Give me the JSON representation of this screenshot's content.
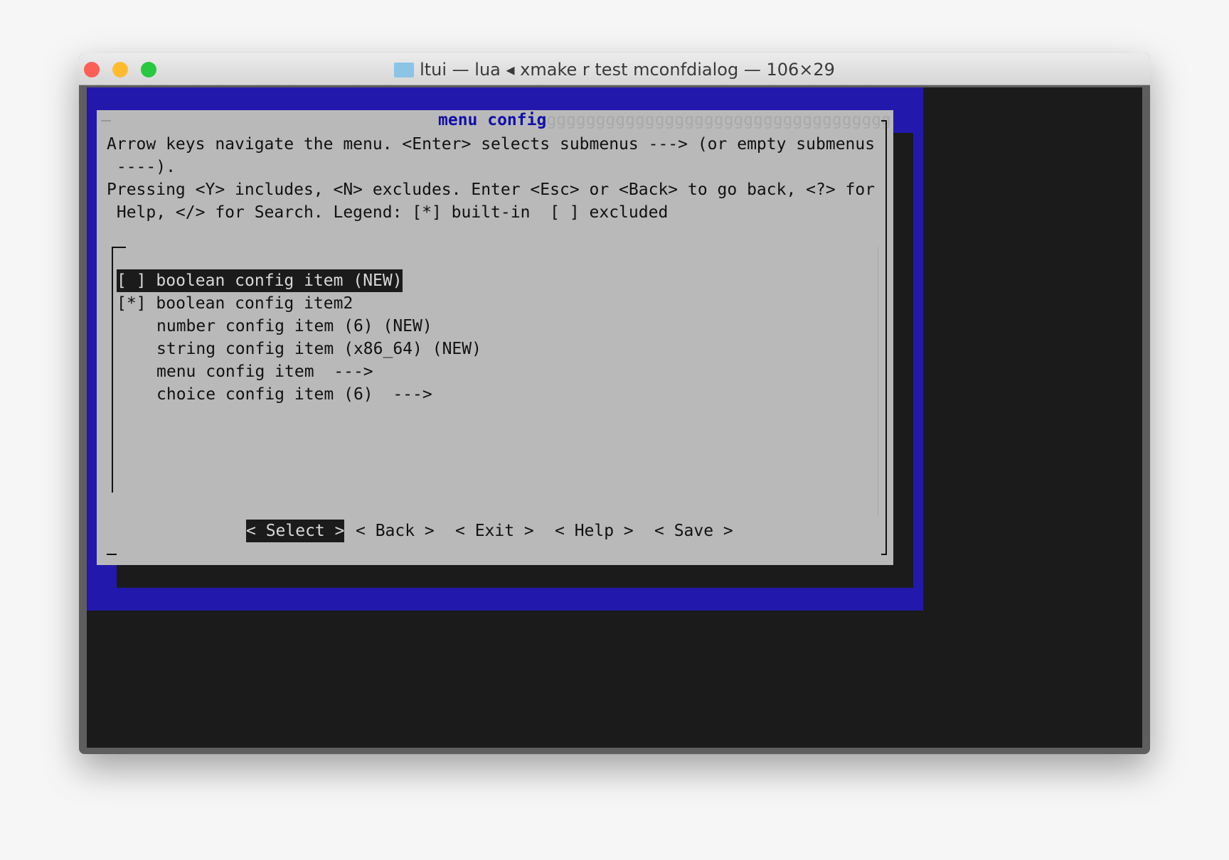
{
  "window": {
    "title": "ltui — lua ◂ xmake r test mconfdialog — 106×29",
    "traffic_lights": {
      "close": "#fd5f57",
      "minimize": "#febb2e",
      "zoom": "#28c840"
    }
  },
  "colors": {
    "screen_bg": "#2219ac",
    "dialog_bg": "#b9b9b9",
    "title": "#1010a8",
    "highlight_bg": "#1b1b1b"
  },
  "dialog": {
    "title": "menu config",
    "title_fill": "ggggggggggggggggggggggggggggggggggg",
    "help_lines": [
      "Arrow keys navigate the menu. <Enter> selects submenus ---> (or empty submenus",
      " ----).",
      "Pressing <Y> includes, <N> excludes. Enter <Esc> or <Back> to go back, <?> for",
      " Help, </> for Search. Legend: [*] built-in  [ ] excluded"
    ],
    "items": [
      {
        "prefix": "[ ]",
        "label": "boolean config item (NEW)",
        "selected": true
      },
      {
        "prefix": "[*]",
        "label": "boolean config item2",
        "selected": false
      },
      {
        "prefix": "",
        "label": "number config item (6) (NEW)",
        "selected": false
      },
      {
        "prefix": "",
        "label": "string config item (x86_64) (NEW)",
        "selected": false
      },
      {
        "prefix": "",
        "label": "menu config item  --->",
        "selected": false
      },
      {
        "prefix": "",
        "label": "choice config item (6)  --->",
        "selected": false
      }
    ],
    "buttons": {
      "select": "< Select >",
      "back": "< Back >",
      "exit": "< Exit >",
      "help": "< Help >",
      "save": "< Save >"
    }
  }
}
